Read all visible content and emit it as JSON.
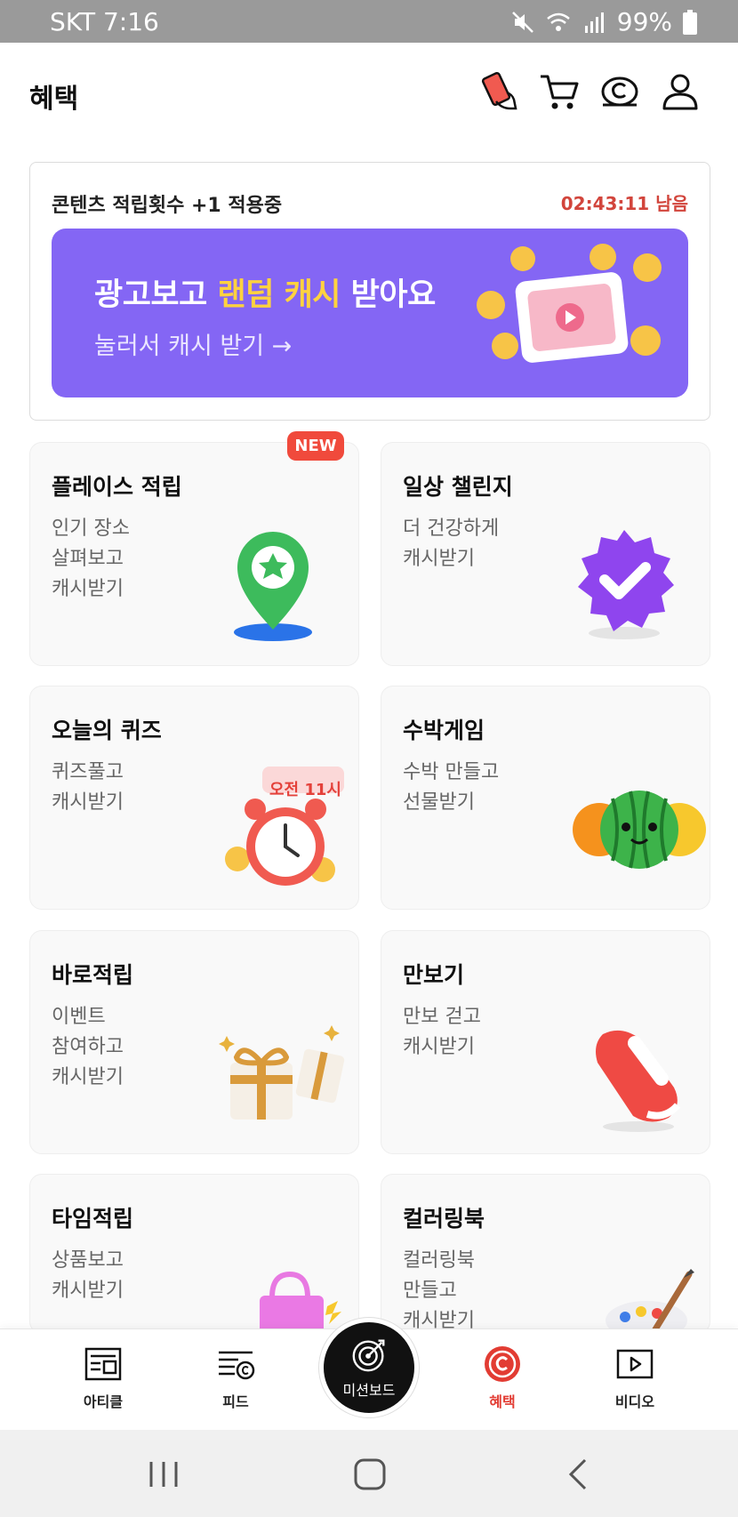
{
  "status_bar": {
    "carrier_time": "SKT 7:16",
    "battery": "99%"
  },
  "header": {
    "title": "혜택",
    "icons": [
      "phone-hand-icon",
      "cart-icon",
      "cash-coin-icon",
      "profile-icon"
    ]
  },
  "promo": {
    "label": "콘텐츠 적립횟수 +1 적용중",
    "timer": "02:43:11 남음",
    "banner": {
      "headline_pre": "광고보고 ",
      "headline_highlight": "랜덤 캐시",
      "headline_post": " 받아요",
      "sub": "눌러서 캐시 받기 →",
      "bg_color": "#8466f4",
      "highlight_color": "#ffd23f"
    }
  },
  "tiles": [
    {
      "title": "플레이스 적립",
      "lines": [
        "인기 장소",
        "살펴보고",
        "캐시받기"
      ],
      "badge": "NEW",
      "icon": "map-pin-star-icon"
    },
    {
      "title": "일상 챌린지",
      "lines": [
        "더 건강하게",
        "캐시받기"
      ],
      "icon": "verified-badge-icon"
    },
    {
      "title": "오늘의 퀴즈",
      "lines": [
        "퀴즈풀고",
        "캐시받기"
      ],
      "tag": "오전 11시",
      "icon": "alarm-clock-icon"
    },
    {
      "title": "수박게임",
      "lines": [
        "수박 만들고",
        "선물받기"
      ],
      "icon": "watermelon-icon"
    },
    {
      "title": "바로적립",
      "lines": [
        "이벤트",
        "참여하고",
        "캐시받기"
      ],
      "icon": "gift-box-icon"
    },
    {
      "title": "만보기",
      "lines": [
        "만보 걷고",
        "캐시받기"
      ],
      "icon": "sneaker-icon"
    },
    {
      "title": "타임적립",
      "lines": [
        "상품보고",
        "캐시받기"
      ],
      "icon": "shopping-bag-icon"
    },
    {
      "title": "컬러링북",
      "lines": [
        "컬러링북",
        "만들고",
        "캐시받기"
      ],
      "icon": "paint-palette-icon"
    }
  ],
  "bottom_nav": {
    "items": [
      {
        "label": "아티클",
        "icon": "article-icon"
      },
      {
        "label": "피드",
        "icon": "feed-icon"
      },
      {
        "label": "미션보드",
        "icon": "target-icon"
      },
      {
        "label": "혜택",
        "icon": "cash-coin-icon",
        "active": true
      },
      {
        "label": "비디오",
        "icon": "video-play-icon"
      }
    ],
    "active_color": "#e23c33"
  }
}
